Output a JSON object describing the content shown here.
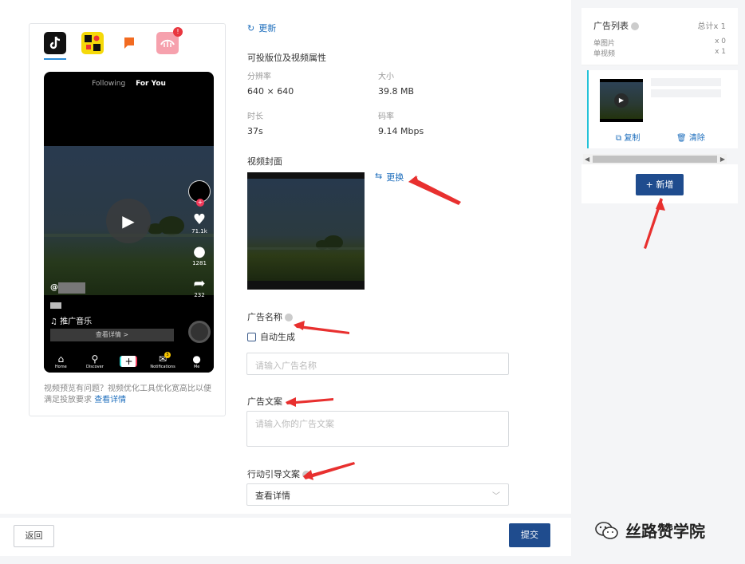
{
  "preview": {
    "app_tabs": [
      {
        "name": "TikTok",
        "icon": "tiktok-icon"
      },
      {
        "name": "TopBuzz",
        "icon": "topbuzz-icon"
      },
      {
        "name": "BaBe",
        "icon": "babe-icon"
      },
      {
        "name": "Pangle",
        "icon": "pangle-icon",
        "badge": "!"
      }
    ],
    "phone": {
      "tab_following": "Following",
      "tab_for_you": "For You",
      "like_count": "71.1k",
      "comment_count": "1281",
      "share_count": "232",
      "handle": "@",
      "music": "♫ 推广音乐",
      "cta": "查看详情 >",
      "nav": [
        "Home",
        "Discover",
        "",
        "Notifications",
        "Me"
      ],
      "notif_badge": "5"
    },
    "note_text": "视频预览有问题？视频优化工具优化宽高比以便满足投放要求",
    "note_link": "查看详情"
  },
  "form": {
    "refresh_label": "更新",
    "props_title": "可投版位及视频属性",
    "resolution_label": "分辨率",
    "resolution_value": "640 × 640",
    "size_label": "大小",
    "size_value": "39.8 MB",
    "duration_label": "时长",
    "duration_value": "37s",
    "bitrate_label": "码率",
    "bitrate_value": "9.14 Mbps",
    "cover_title": "视频封面",
    "replace_label": "更换",
    "ad_name_label": "广告名称",
    "auto_generate_label": "自动生成",
    "ad_name_placeholder": "请输入广告名称",
    "ad_text_label": "广告文案",
    "ad_text_placeholder": "请输入你的广告文案",
    "cta_label": "行动引导文案",
    "cta_value": "查看详情"
  },
  "footer": {
    "back_label": "返回",
    "submit_label": "提交"
  },
  "ad_list": {
    "title": "广告列表",
    "total": "总计x 1",
    "single_image_label": "单图片",
    "single_image_count": "x 0",
    "single_video_label": "单视频",
    "single_video_count": "x 1",
    "copy_label": "复制",
    "clear_label": "清除",
    "add_label": "+ 新增"
  },
  "watermark": {
    "text": "丝路赞学院"
  },
  "colors": {
    "primary": "#1f4c8e",
    "link": "#1f6fbd",
    "accent_bar": "#22c2d8",
    "annotation_arrow": "#e8302f"
  }
}
